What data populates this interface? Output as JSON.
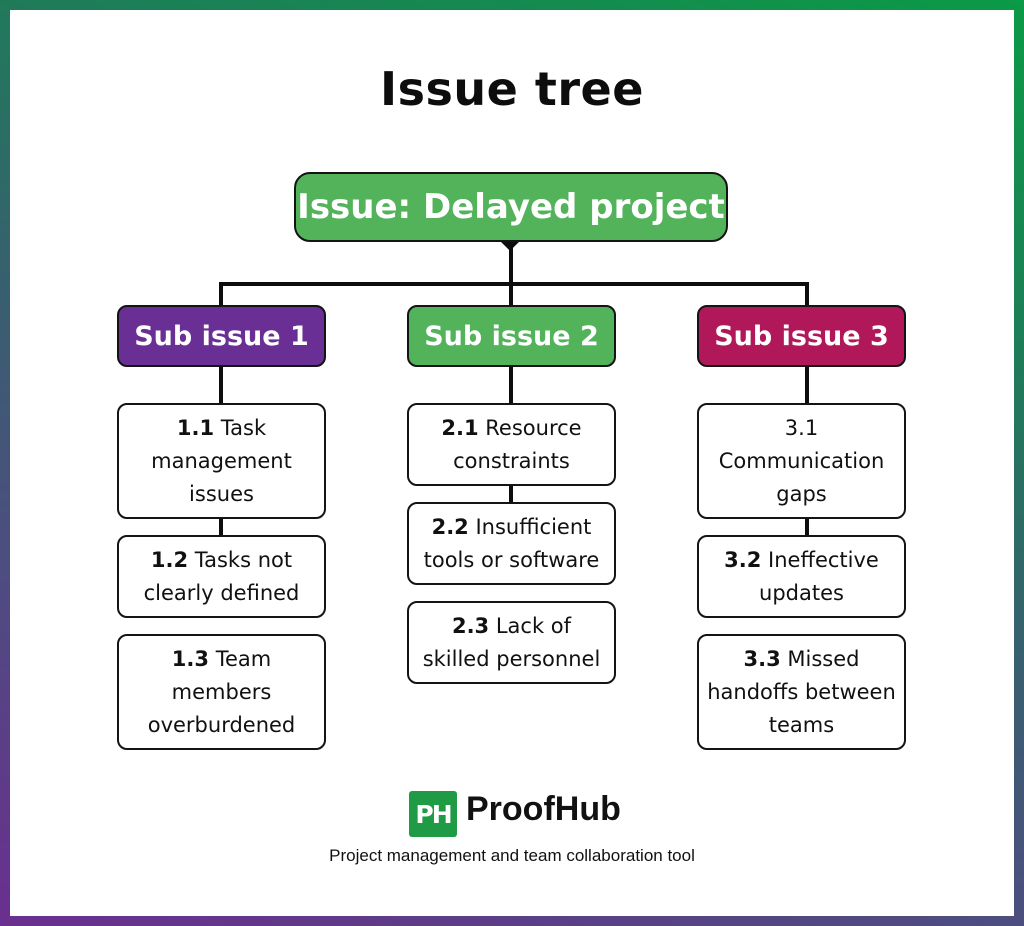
{
  "title": "Issue tree",
  "colors": {
    "root": "#52b35b",
    "sub_issue_1": "#6a2f94",
    "sub_issue_2": "#52b35b",
    "sub_issue_3": "#b0185a",
    "brand": "#1f9a45"
  },
  "root": {
    "label": "Issue: Delayed project"
  },
  "sub_issues": [
    {
      "label": "Sub issue 1",
      "items": [
        {
          "num": "1.1",
          "text": "Task management issues"
        },
        {
          "num": "1.2",
          "text": "Tasks not clearly defined"
        },
        {
          "num": "1.3",
          "text": "Team members overburdened"
        }
      ]
    },
    {
      "label": "Sub issue 2",
      "items": [
        {
          "num": "2.1",
          "text": "Resource constraints"
        },
        {
          "num": "2.2",
          "text": "Insufficient tools or software"
        },
        {
          "num": "2.3",
          "text": "Lack of skilled personnel"
        }
      ]
    },
    {
      "label": "Sub issue 3",
      "items": [
        {
          "num": "3.1",
          "text": "Communication gaps"
        },
        {
          "num": "3.2",
          "text": "Ineffective updates"
        },
        {
          "num": "3.3",
          "text": "Missed handoffs between teams"
        }
      ]
    }
  ],
  "footer": {
    "logo_mark": "PH",
    "brand_name": "ProofHub",
    "tagline": "Project management and team collaboration tool"
  }
}
